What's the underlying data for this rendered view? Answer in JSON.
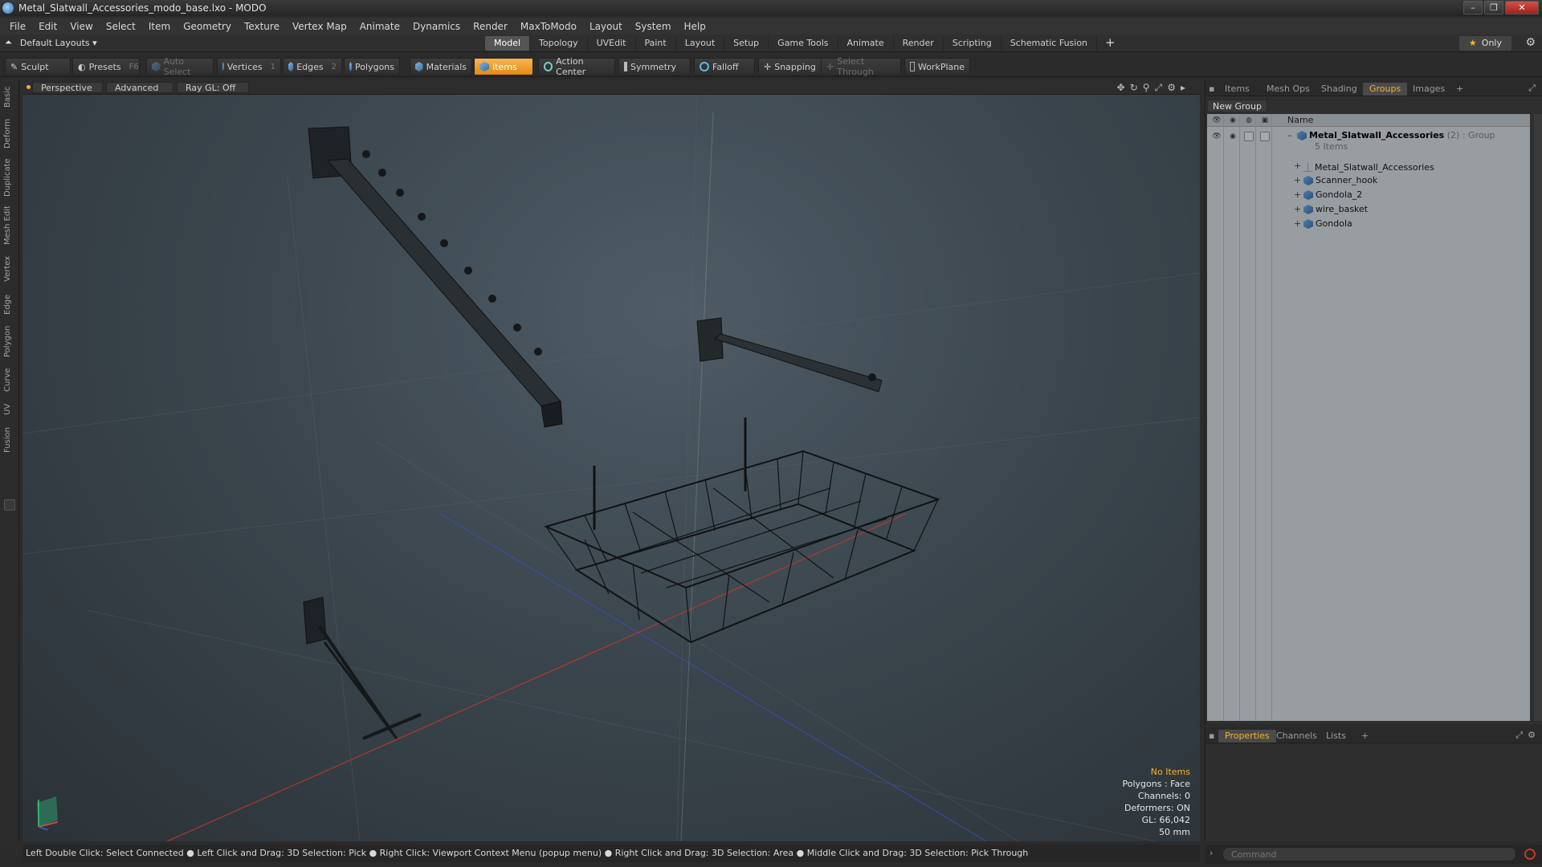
{
  "window": {
    "title": "Metal_Slatwall_Accessories_modo_base.lxo - MODO",
    "controls": [
      "–",
      "❐",
      "✕"
    ]
  },
  "menu": [
    "File",
    "Edit",
    "View",
    "Select",
    "Item",
    "Geometry",
    "Texture",
    "Vertex Map",
    "Animate",
    "Dynamics",
    "Render",
    "MaxToModo",
    "Layout",
    "System",
    "Help"
  ],
  "layoutbar": {
    "layout_menu": "Default Layouts ▾",
    "tabs": [
      "Model",
      "Topology",
      "UVEdit",
      "Paint",
      "Layout",
      "Setup",
      "Game Tools",
      "Animate",
      "Render",
      "Scripting",
      "Schematic Fusion"
    ],
    "active_tab": "Model",
    "add": "+",
    "only_label": "Only",
    "star": "★",
    "gear": "⚙"
  },
  "toolbar": {
    "sculpt": "Sculpt",
    "presets": "Presets",
    "presets_key": "F6",
    "auto_select": "Auto Select",
    "vertices": "Vertices",
    "vertices_key": "1",
    "edges": "Edges",
    "edges_key": "2",
    "polygons": "Polygons",
    "materials": "Materials",
    "items": "Items",
    "action_center": "Action Center",
    "symmetry": "Symmetry",
    "falloff": "Falloff",
    "snapping": "Snapping",
    "select_through": "Select Through",
    "workplane": "WorkPlane"
  },
  "left_tabs": [
    "Basic",
    "Deform",
    "Duplicate",
    "Mesh Edit",
    "Vertex",
    "Edge",
    "Polygon",
    "Curve",
    "UV",
    "Fusion"
  ],
  "viewport": {
    "view_mode": "Perspective",
    "shading": "Advanced",
    "raygl": "Ray GL: Off",
    "icons": [
      "✥",
      "↻",
      "⚲",
      "⤢",
      "⚙",
      "▸"
    ],
    "info": {
      "no_items": "No Items",
      "polygons": "Polygons : Face",
      "channels": "Channels: 0",
      "deformers": "Deformers: ON",
      "gl": "GL: 66,042",
      "scale": "50 mm"
    }
  },
  "right_panel": {
    "tabs": [
      "Items",
      "Mesh Ops",
      "Shading",
      "Groups",
      "Images"
    ],
    "active_tab": "Groups",
    "add": "+",
    "new_group": "New Group",
    "column_header": "Name",
    "group": {
      "name": "Metal_Slatwall_Accessories",
      "count": "(2)",
      "kind": ": Group",
      "sub": "5 Items"
    },
    "items": [
      "Metal_Slatwall_Accessories",
      "Scanner_hook",
      "Gondola_2",
      "wire_basket",
      "Gondola"
    ]
  },
  "properties_panel": {
    "tabs": [
      "Properties",
      "Channels",
      "Lists"
    ],
    "active_tab": "Properties",
    "add": "+"
  },
  "status": {
    "text": "Left Double Click: Select Connected ● Left Click and Drag: 3D Selection: Pick ● Right Click: Viewport Context Menu (popup menu) ● Right Click and Drag: 3D Selection: Area ● Middle Click and Drag: 3D Selection: Pick Through"
  },
  "command": {
    "placeholder": "Command",
    "arrow": "›"
  },
  "colors": {
    "accent": "#f3b233",
    "active_button": "#e38a12",
    "viewport_bg": "#3b464e"
  }
}
